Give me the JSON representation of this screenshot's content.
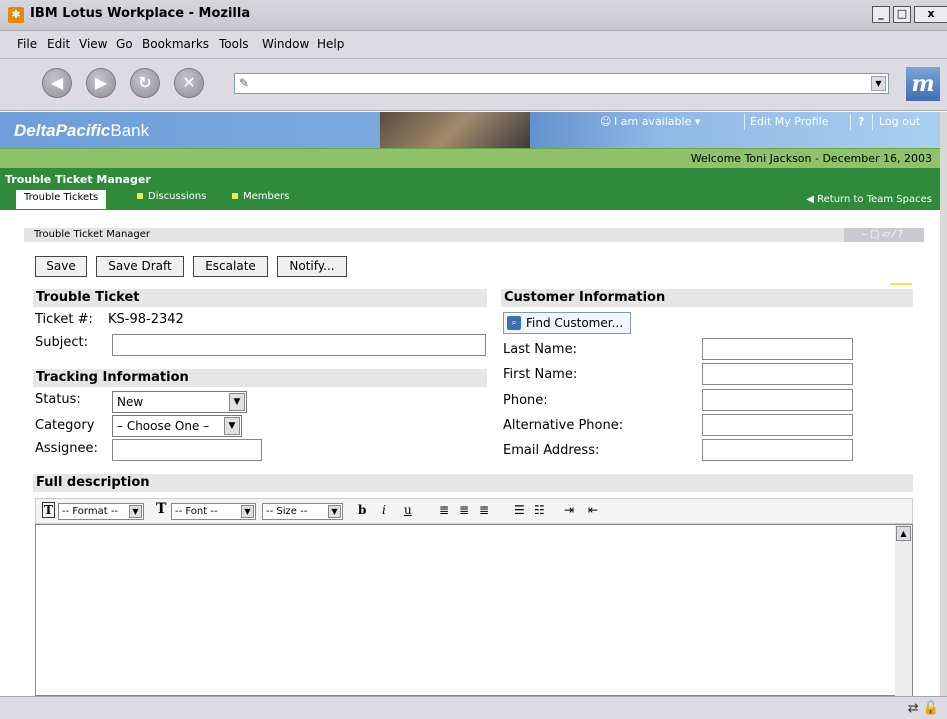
{
  "window": {
    "title": "IBM Lotus Workplace - Mozilla",
    "icon": "lotus-workplace-icon",
    "controls": [
      "_",
      "□",
      "x"
    ]
  },
  "menubar": [
    "File",
    "Edit",
    "View",
    "Go",
    "Bookmarks",
    "Tools",
    "Window",
    "Help"
  ],
  "navbar": {
    "url_value": "",
    "buttons": [
      "back",
      "forward",
      "reload",
      "stop"
    ]
  },
  "bank": {
    "logo_bold": "DeltaPacific",
    "logo_light": "Bank",
    "availability": "I am available ▾",
    "edit_profile": "Edit My Profile",
    "help": "?",
    "logout": "Log out",
    "welcome": "Welcome Toni Jackson - December 16, 2003"
  },
  "app": {
    "title": "Trouble Ticket Manager",
    "tabs": [
      {
        "label": "Trouble Tickets",
        "active": true
      },
      {
        "label": "Discussions",
        "active": false
      },
      {
        "label": "Members",
        "active": false
      }
    ],
    "return_link": "◀ Return to Team Spaces"
  },
  "portlet": {
    "title": "Trouble Ticket Manager",
    "controls": "–▢▱⁄?"
  },
  "actions": {
    "save": "Save",
    "save_draft": "Save Draft",
    "escalate": "Escalate",
    "notify": "Notify..."
  },
  "trouble_ticket": {
    "heading": "Trouble Ticket",
    "ticket_label": "Ticket #:",
    "ticket_value": "KS-98-2342",
    "subject_label": "Subject:",
    "subject_value": ""
  },
  "tracking": {
    "heading": "Tracking Information",
    "status_label": "Status:",
    "status_value": "New",
    "category_label": "Category",
    "category_value": "– Choose One –",
    "assignee_label": "Assignee:",
    "assignee_value": ""
  },
  "customer": {
    "heading": "Customer Information",
    "find_button": "Find Customer...",
    "last_name_label": "Last Name:",
    "first_name_label": "First Name:",
    "phone_label": "Phone:",
    "alt_phone_label": "Alternative Phone:",
    "email_label": "Email Address:"
  },
  "description": {
    "heading": "Full description",
    "format_select": "-- Format --",
    "font_select": "-- Font --",
    "size_select": "-- Size --",
    "bold": "b",
    "italic": "i",
    "underline": "u"
  }
}
